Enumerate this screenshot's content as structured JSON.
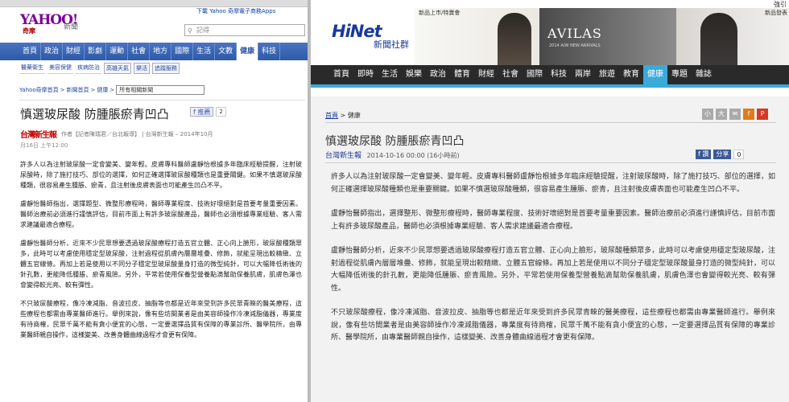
{
  "left": {
    "top_bar": "",
    "ad_link": "下載 Yahoo 奇摩電子商務Apps",
    "logo": "YAHOO!",
    "logo_sub": "奇摩",
    "section": "新聞",
    "search_placeholder": "記得",
    "nav": [
      "首頁",
      "政治",
      "財經",
      "影劇",
      "運動",
      "社會",
      "地方",
      "國際",
      "生活",
      "文教",
      "健康",
      "科技"
    ],
    "nav_active": 10,
    "subnav": [
      "醫藥衛生",
      "美容保健",
      "疾病防治",
      "高雄天氣",
      "樂活",
      "追蹤服務"
    ],
    "breadcrumb": [
      "Yahoo奇摩首頁",
      "新聞首頁",
      "健康"
    ],
    "breadcrumb_select": "所有相關新聞",
    "title": "慎選玻尿酸 防腫脹瘀青凹凸",
    "share_label": "f 推薦",
    "share_count": "2",
    "source_logo": "台灣新生報",
    "source_meta": "作者【記者陳瑞君／台北報導】 | 台灣新生報 – 2014年10月",
    "date": "月16日 上午12:00",
    "paragraphs": [
      "許多人以為注射玻尿酸一定會變美、變年輕。皮膚專科醫師盧靜怡根據多年臨床經驗提醒，注射玻尿酸時，除了施打技巧、部位的選擇，如何正確選擇玻尿酸種類也是重要關鍵。如果不慎選玻尿酸種類，很容易產生腫脹、瘀青，且注射後皮膚表面也可能產生凹凸不平。",
      "盧靜怡醫師指出，選擇題型、微整形療程時，醫師專業程度、技術好壞絕對是首要考量重要因素。醫師治療前必須進行謹慎評估，目前市面上有許多玻尿酸產品，醫師也必須根據專業經驗、客人需求建議最適合療程。",
      "盧靜怡醫師分析，近來不少民眾想要透過玻尿酸療程打造五官立體、正心向上臉形，玻尿酸種類眾多，此時可以考慮使用穩定型玻尿酸，注射過程從肌膚內層層堆疊、修飾，就能呈現出較精緻、立體五官線條。再加上若是使用以不同分子穩定型玻尿酸量身打造的微型純針，可以大幅降低術後的針孔數，更能降低腫脹、瘀青風險。另外，平常若使用保養型營養點滴幫助保養肌膚，肌膚色澤也會變得較光亮、較有彈性。",
      "不只玻尿酸療程，像冷凍減脂、音波拉皮、抽脂等也都是近年來受到許多民眾青睞的醫美療程，這些療程也都需由專業醫師進行。舉例來說，像有些坊間業者是由美容師操作冷凍減脂儀器，專業度有待商榷，民眾千萬不能有貪小便宜的心態，一定要選擇品質有保障的專業診所、醫學院所，由專業醫師親自操作，這樣變美、改善身體曲線過程才會更有保障。"
    ]
  },
  "right": {
    "corner": "強引",
    "logo": "HiNet",
    "sub": "新聞社群",
    "ad_left": "新品上市/特賣會",
    "ad_brand": "AVILAS",
    "ad_brand_sub": "2014 A/W NEW ARRIVALS",
    "ad_right": "新品發表",
    "nav": [
      "首頁",
      "即時",
      "生活",
      "娛樂",
      "政治",
      "體育",
      "財經",
      "社會",
      "國際",
      "科技",
      "兩岸",
      "旅遊",
      "教育",
      "健康",
      "專題",
      "雜誌"
    ],
    "nav_active": 13,
    "breadcrumb_home": "首頁",
    "breadcrumb_sep": ">",
    "breadcrumb_current": "健康",
    "tool_icons": [
      "小",
      "大",
      "✉",
      "f",
      "P"
    ],
    "title": "慎選玻尿酸 防腫脹瘀青凹凸",
    "source": "台灣新生報",
    "meta": "2014-10-16 00:00 (16小時前)",
    "share_btn": "f 讚",
    "share_count": "0",
    "share_btn2": "分享",
    "paragraphs": [
      "許多人以為注射玻尿酸一定會變美、變年輕。皮膚專科醫師盧靜怡根據多年臨床經驗提醒，注射玻尿酸時，除了施打技巧、部位的選擇，如何正確選擇玻尿酸種類也是重要關鍵。如果不慎選玻尿酸種類，很容易產生腫脹、瘀青，且注射後皮膚表面也可能產生凹凸不平。",
      "盧靜怡醫師指出，選擇整形、微整形療程時，醫師專業程度、技術好壞絕對是首要考量重要因素。醫師治療前必須進行謹慎評估，目前市面上有許多玻尿酸產品，醫師也必須根據專業經驗、客人需求建議最適合療程。",
      "盧靜怡醫師分析，近來不少民眾想要透過玻尿酸療程打造五官立體、正心向上臉形，玻尿酸種類眾多，此時可以考慮使用穩定型玻尿酸，注射過程從肌膚內層層堆疊、修飾，就能呈現出較精緻、立體五官線條。再加上若是使用以不同分子穩定型玻尿酸量身打造的微型純針，可以大幅降低術後的針孔數，更能降低腫脹、瘀青風險。另外，平常若使用保養型營養點滴幫助保養肌膚，肌膚色澤也會變得較光亮、較有彈性。",
      "不只玻尿酸療程，像冷凍減脂、音波拉皮、抽脂等也都是近年來受到許多民眾青睞的醫美療程，這些療程也都需由專業醫師進行。舉例來說，像有些坊間業者是由美容師操作冷凍減脂儀器，專業度有待商榷，民眾千萬不能有貪小便宜的心態，一定要選擇品質有保障的專業診所、醫學院所，由專業醫師親自操作，這樣變美、改善身體曲線過程才會更有保障。"
    ]
  },
  "colors": {
    "yahoo_nav": "#2e5aa6",
    "hinet_nav": "#2a2a2a",
    "hinet_accent": "#3ba9d9",
    "fb": "#3b5998"
  }
}
